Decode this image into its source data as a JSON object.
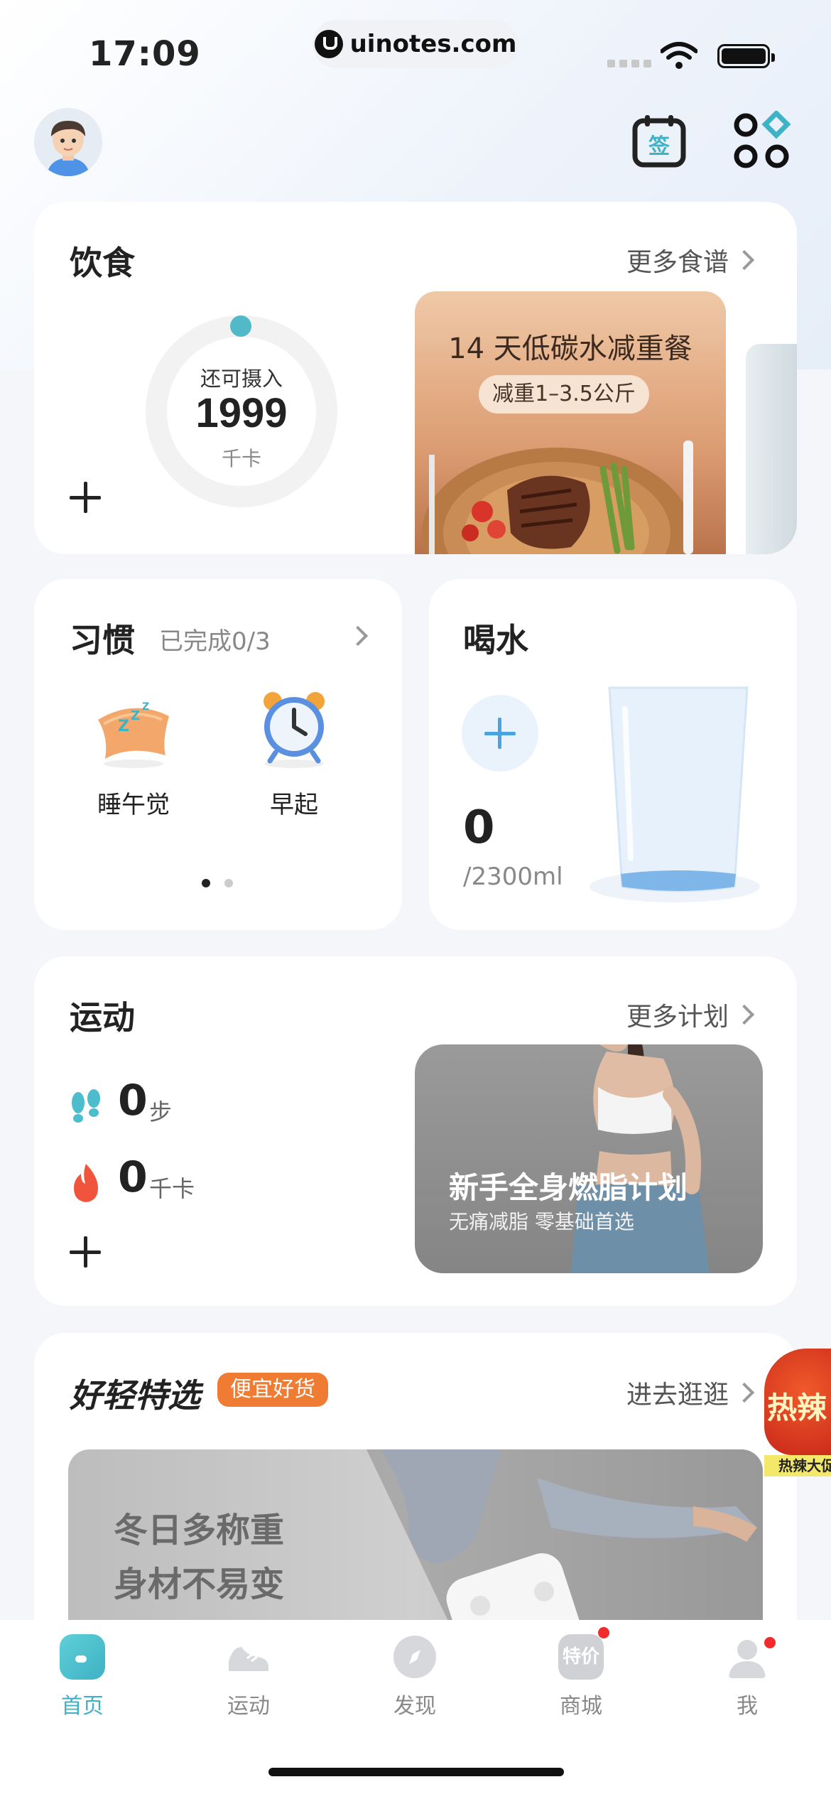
{
  "status_bar": {
    "time": "17:09",
    "url": "uinotes.com"
  },
  "diet": {
    "title": "饮食",
    "more": "更多食谱",
    "remaining_label": "还可摄入",
    "remaining_value": "1999",
    "unit": "千卡",
    "promo_title": "14 天低碳水减重餐",
    "promo_tag": "减重1–3.5公斤"
  },
  "habits": {
    "title": "习惯",
    "progress": "已完成0/3",
    "items": [
      {
        "label": "睡午觉"
      },
      {
        "label": "早起"
      }
    ],
    "page_count": 2,
    "active_page": 1
  },
  "water": {
    "title": "喝水",
    "value": "0",
    "goal": "/2300ml"
  },
  "exercise": {
    "title": "运动",
    "more": "更多计划",
    "steps_value": "0",
    "steps_unit": "步",
    "calories_value": "0",
    "calories_unit": "千卡",
    "promo_title": "新手全身燃脂计划",
    "promo_subtitle": "无痛减脂 零基础首选"
  },
  "shop": {
    "title": "好轻特选",
    "tag": "便宜好货",
    "more": "进去逛逛",
    "banner_line1": "冬日多称重",
    "banner_line2": "身材不易变",
    "floating_ad_text": "热辣",
    "floating_ad_sub": "热辣大促"
  },
  "tabbar": {
    "items": [
      {
        "label": "首页",
        "active": true
      },
      {
        "label": "运动"
      },
      {
        "label": "发现"
      },
      {
        "label": "商城",
        "icon_text": "特价",
        "badge": true
      },
      {
        "label": "我",
        "badge": true
      }
    ]
  },
  "colors": {
    "accent": "#52b9c9",
    "water": "#4aa3df",
    "tag_orange": "#f07b32",
    "badge": "#f02b2b"
  }
}
